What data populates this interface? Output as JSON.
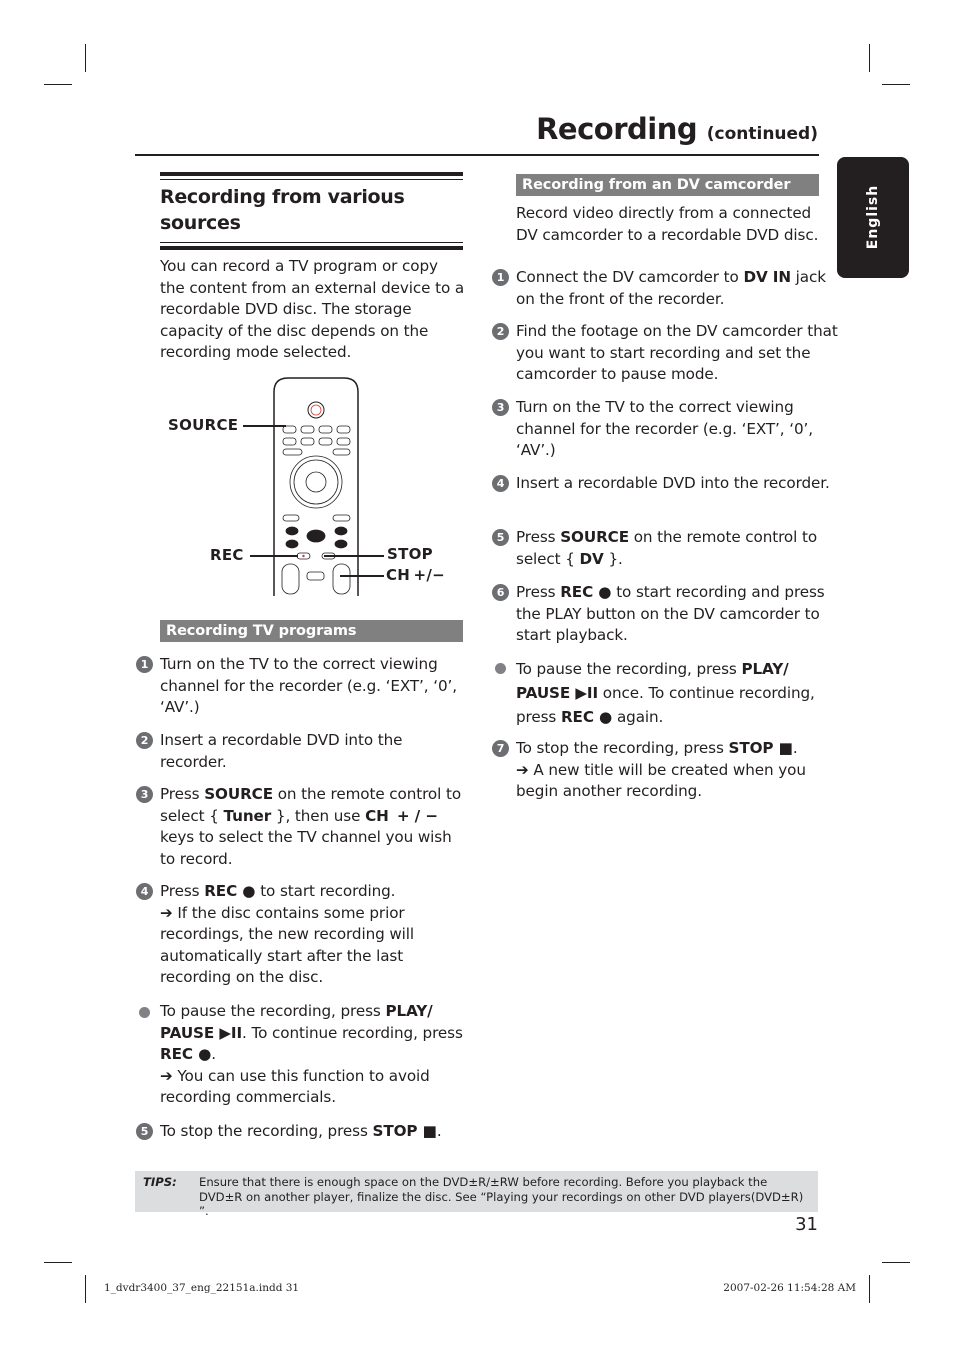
{
  "header": {
    "title": "Recording",
    "title_suffix": "(continued)"
  },
  "language_tab": "English",
  "left": {
    "section_title_line1": "Recording from various",
    "section_title_line2": "sources",
    "intro": "You can record a TV program or copy the content from an external device to a recordable DVD disc. The storage capacity of the disc depends on the recording mode selected.",
    "remote_labels": {
      "source": "SOURCE",
      "rec": "REC",
      "stop": "STOP",
      "ch": "CH +/−"
    },
    "tv_bar": "Recording  TV programs",
    "steps": [
      {
        "num": "1",
        "text": "Turn on the TV to the correct viewing channel for the recorder (e.g. ‘EXT’, ‘0’, ‘AV’.)"
      },
      {
        "num": "2",
        "text": "Insert a recordable DVD into the recorder."
      },
      {
        "num": "3",
        "pre": "Press ",
        "b1": "SOURCE",
        "mid": " on the remote control to select { ",
        "b2": "Tuner",
        "mid2": " }, then use ",
        "b3": "CH  + / −",
        "post": " keys to select the TV channel you wish to record."
      },
      {
        "num": "4",
        "pre": "Press ",
        "b1": "REC ●",
        "post": " to start recording.",
        "sub": "➔ If the disc contains some prior recordings, the new recording will automatically start after the last recording on the disc."
      },
      {
        "bullet": true,
        "pre": "To pause the recording, press ",
        "b1": "PLAY/ PAUSE ▶II",
        "mid": ".  To continue recording, press ",
        "b2": "REC ●",
        "post": ".",
        "sub": "➔ You can use this function to avoid recording commercials."
      },
      {
        "num": "5",
        "pre": "To stop the recording, press ",
        "b1": "STOP ■",
        "post": "."
      }
    ]
  },
  "right": {
    "dv_bar": "Recording from an DV camcorder",
    "intro": "Record video directly from a connected DV camcorder to a recordable DVD disc.",
    "steps": [
      {
        "num": "1",
        "pre": "Connect the DV camcorder to ",
        "b1": "DV IN",
        "post": " jack on the front of the recorder."
      },
      {
        "num": "2",
        "text": "Find the footage on the DV camcorder that you want to start recording and set the camcorder to pause mode."
      },
      {
        "num": "3",
        "text": "Turn on the TV to the correct viewing channel for the recorder (e.g. ‘EXT’, ‘0’, ‘AV’.)"
      },
      {
        "num": "4",
        "text": "Insert a recordable DVD into the recorder."
      },
      {
        "num": "5",
        "pre": "Press ",
        "b1": "SOURCE",
        "mid": " on the remote control to select { ",
        "b2": "DV",
        "post": " }."
      },
      {
        "num": "6",
        "pre": "Press ",
        "b1": "REC ●",
        "post": " to start recording and press the PLAY button on the DV camcorder to start playback."
      },
      {
        "bullet": true,
        "pre": "To pause the recording, press ",
        "b1": "PLAY/ PAUSE ▶II",
        "mid": " once. To continue recording, press ",
        "b2": "REC ●",
        "post": " again."
      },
      {
        "num": "7",
        "pre": "To stop the recording, press ",
        "b1": "STOP ■",
        "post": ".",
        "sub": "➔ A new title will be created when you begin another recording."
      }
    ]
  },
  "tips": {
    "label": "TIPS:",
    "text": "Ensure that there is enough space on the DVD±R/±RW before recording. Before you playback the DVD±R on another player, finalize the disc. See “Playing your recordings on other DVD players(DVD±R) ”."
  },
  "page_number": "31",
  "slug": {
    "file": "1_dvdr3400_37_eng_22151a.indd   31",
    "timestamp": "2007-02-26   11:54:28 AM"
  }
}
